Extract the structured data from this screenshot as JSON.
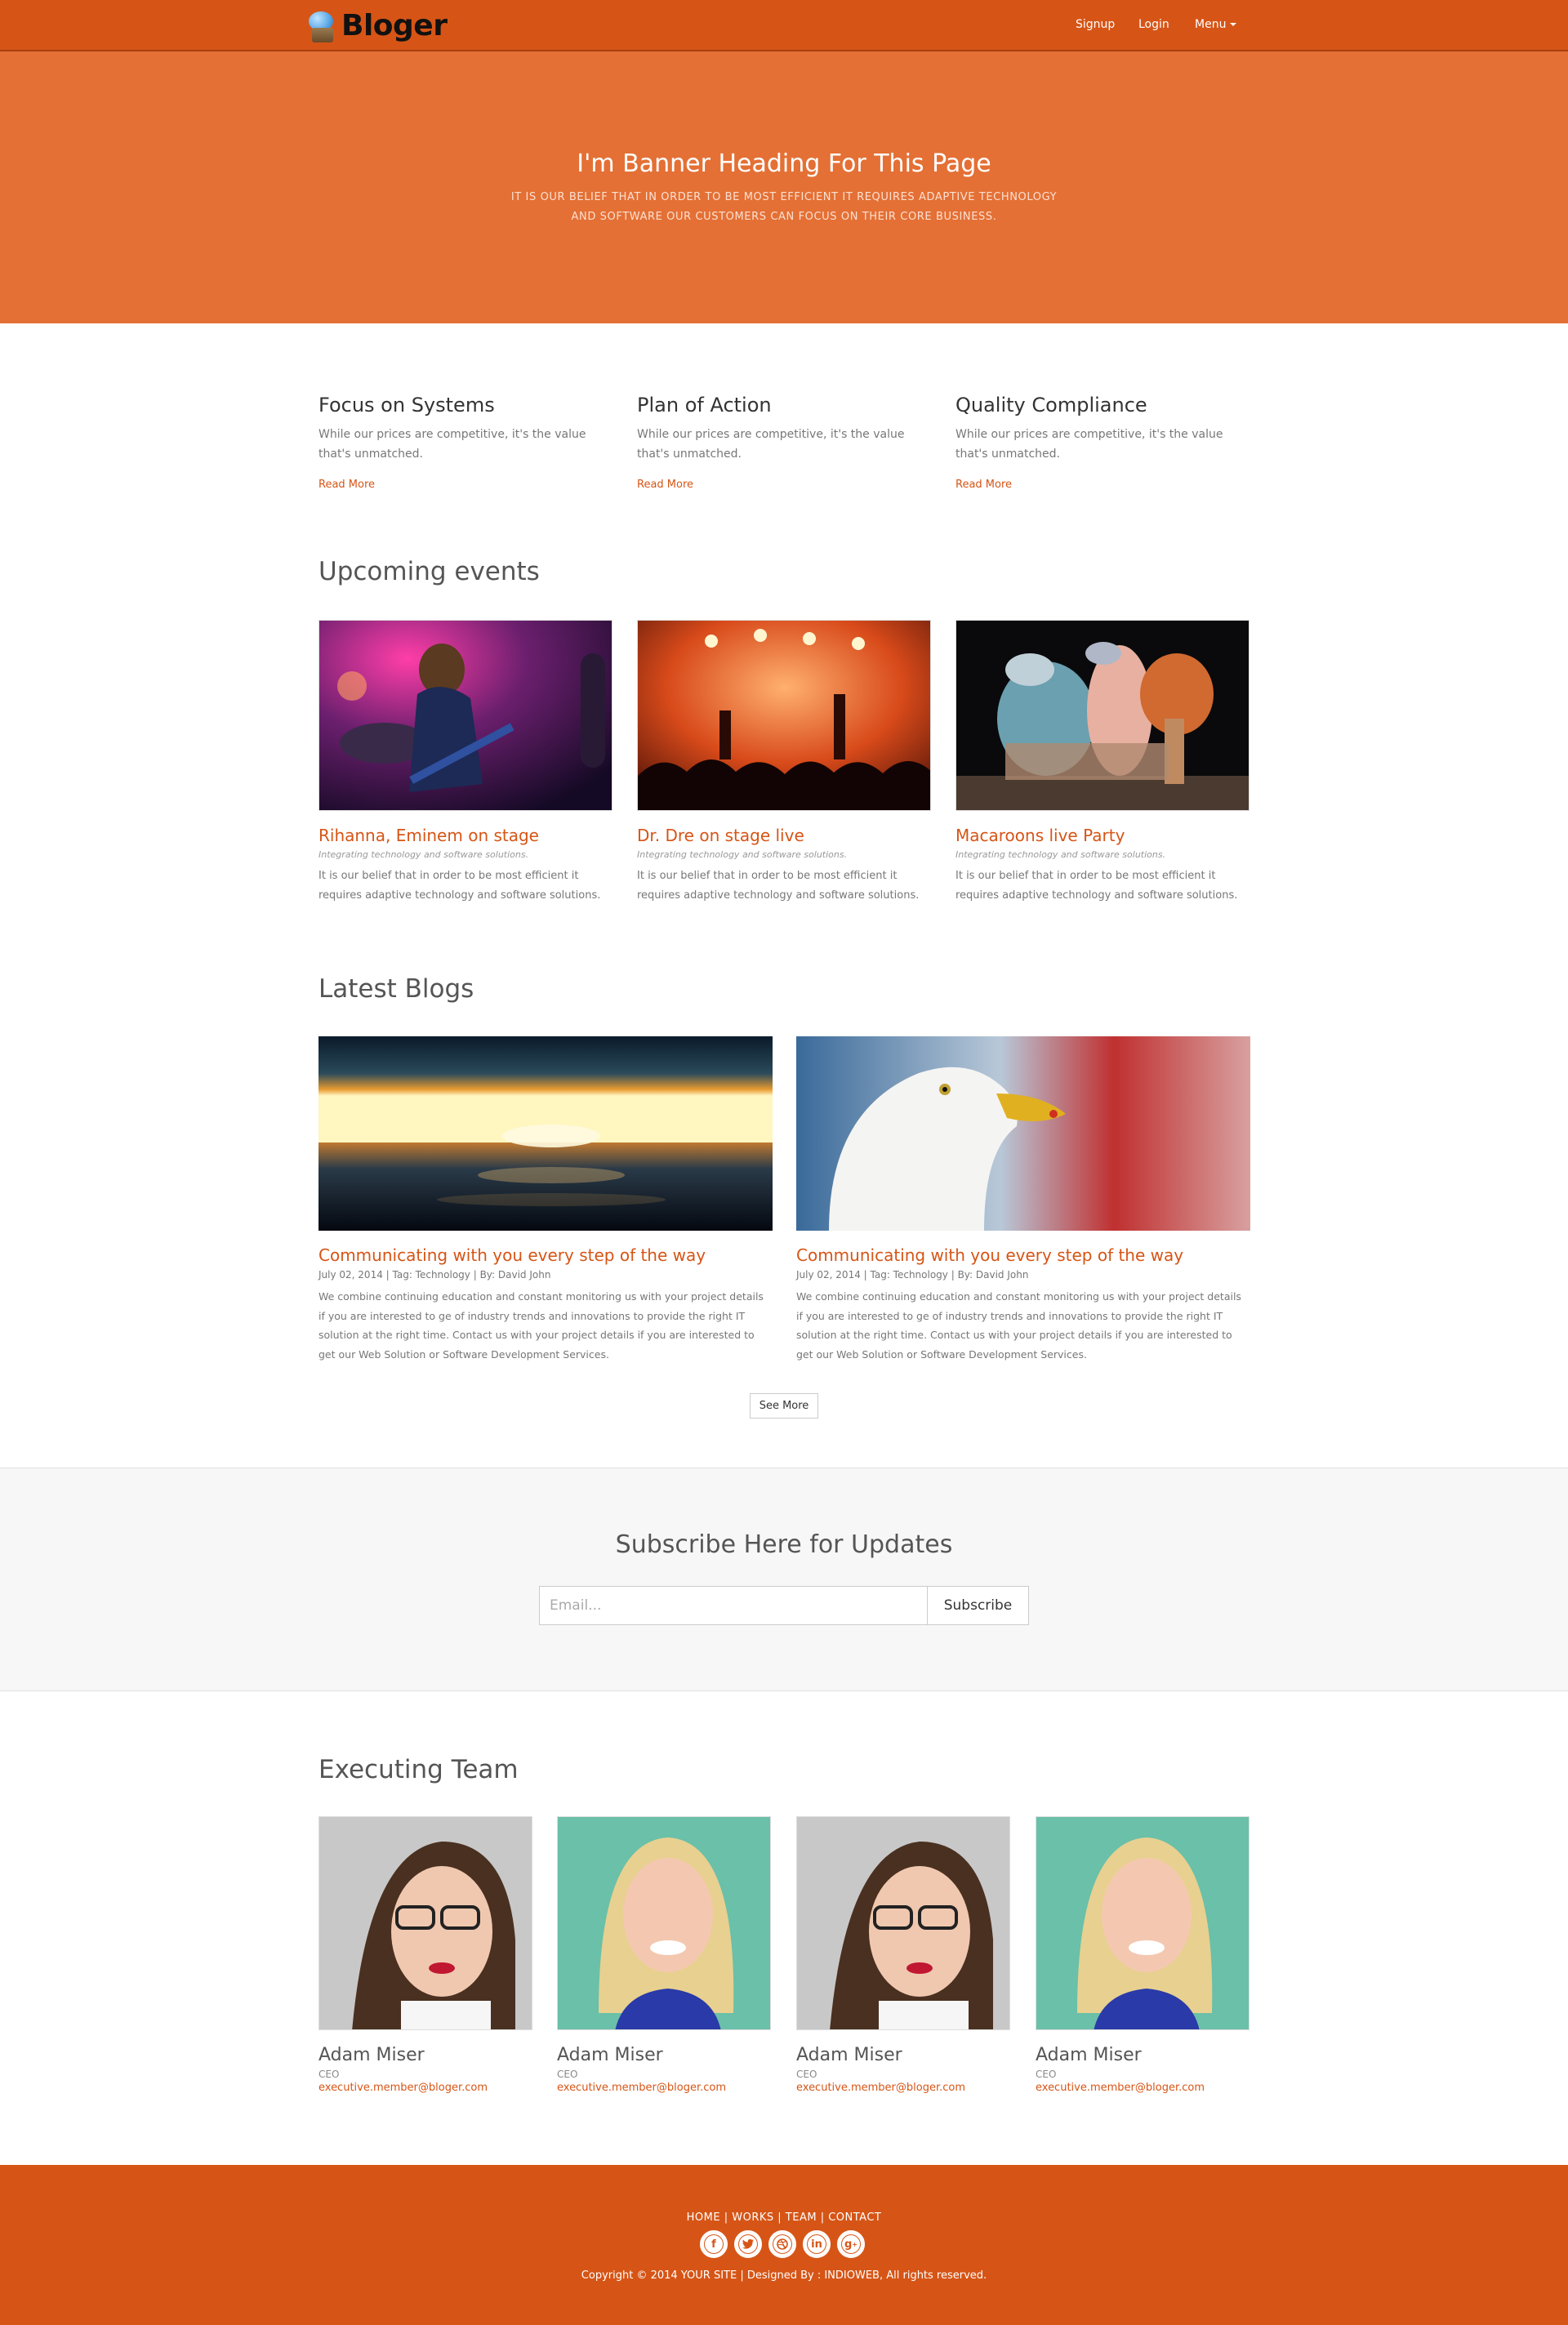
{
  "nav": {
    "brand": "Bloger",
    "signup": "Signup",
    "login": "Login",
    "menu": "Menu"
  },
  "banner": {
    "heading": "I'm Banner Heading For This Page",
    "text": "IT IS OUR BELIEF THAT IN ORDER TO BE MOST EFFICIENT IT REQUIRES ADAPTIVE TECHNOLOGY AND SOFTWARE OUR CUSTOMERS CAN FOCUS ON THEIR CORE BUSINESS."
  },
  "features": [
    {
      "title": "Focus on Systems",
      "text": "While our prices are competitive, it's the value that's unmatched.",
      "link": "Read More"
    },
    {
      "title": "Plan of Action",
      "text": "While our prices are competitive, it's the value that's unmatched.",
      "link": "Read More"
    },
    {
      "title": "Quality Compliance",
      "text": "While our prices are competitive, it's the value that's unmatched.",
      "link": "Read More"
    }
  ],
  "events": {
    "title": "Upcoming events",
    "items": [
      {
        "title": "Rihanna, Eminem on stage",
        "subtitle": "Integrating technology and software solutions.",
        "text": "It is our belief that in order to be most efficient it requires adaptive technology and software solutions."
      },
      {
        "title": "Dr. Dre on stage live",
        "subtitle": "Integrating technology and software solutions.",
        "text": "It is our belief that in order to be most efficient it requires adaptive technology and software solutions."
      },
      {
        "title": "Macaroons live Party",
        "subtitle": "Integrating technology and software solutions.",
        "text": "It is our belief that in order to be most efficient it requires adaptive technology and software solutions."
      }
    ]
  },
  "blogs": {
    "title": "Latest Blogs",
    "items": [
      {
        "title": "Communicating with you every step of the way",
        "meta": "July 02, 2014 | Tag: Technology | By: David John",
        "text": "We combine continuing education and constant monitoring us with your project details if you are interested to ge of industry trends and innovations to provide the right IT solution at the right time. Contact us with your project details if you are interested to get our Web Solution or Software Development Services."
      },
      {
        "title": "Communicating with you every step of the way",
        "meta": "July 02, 2014 | Tag: Technology | By: David John",
        "text": "We combine continuing education and constant monitoring us with your project details if you are interested to ge of industry trends and innovations to provide the right IT solution at the right time. Contact us with your project details if you are interested to get our Web Solution or Software Development Services."
      }
    ],
    "see_more": "See More"
  },
  "subscribe": {
    "title": "Subscribe Here for Updates",
    "placeholder": "Email...",
    "button": "Subscribe"
  },
  "team": {
    "title": "Executing Team",
    "members": [
      {
        "name": "Adam Miser",
        "role": "CEO",
        "email": "executive.member@bloger.com"
      },
      {
        "name": "Adam Miser",
        "role": "CEO",
        "email": "executive.member@bloger.com"
      },
      {
        "name": "Adam Miser",
        "role": "CEO",
        "email": "executive.member@bloger.com"
      },
      {
        "name": "Adam Miser",
        "role": "CEO",
        "email": "executive.member@bloger.com"
      }
    ]
  },
  "footer": {
    "links": [
      "HOME",
      "WORKS",
      "TEAM",
      "CONTACT"
    ],
    "socials": [
      "facebook-icon",
      "twitter-icon",
      "dribbble-icon",
      "linkedin-icon",
      "google-plus-icon"
    ],
    "copyright": "Copyright © 2014 YOUR SITE | Designed By : INDIOWEB, All rights reserved."
  },
  "colors": {
    "brand": "#d65516",
    "banner": "#e47035",
    "subscribe_bg": "#f7f7f7"
  }
}
